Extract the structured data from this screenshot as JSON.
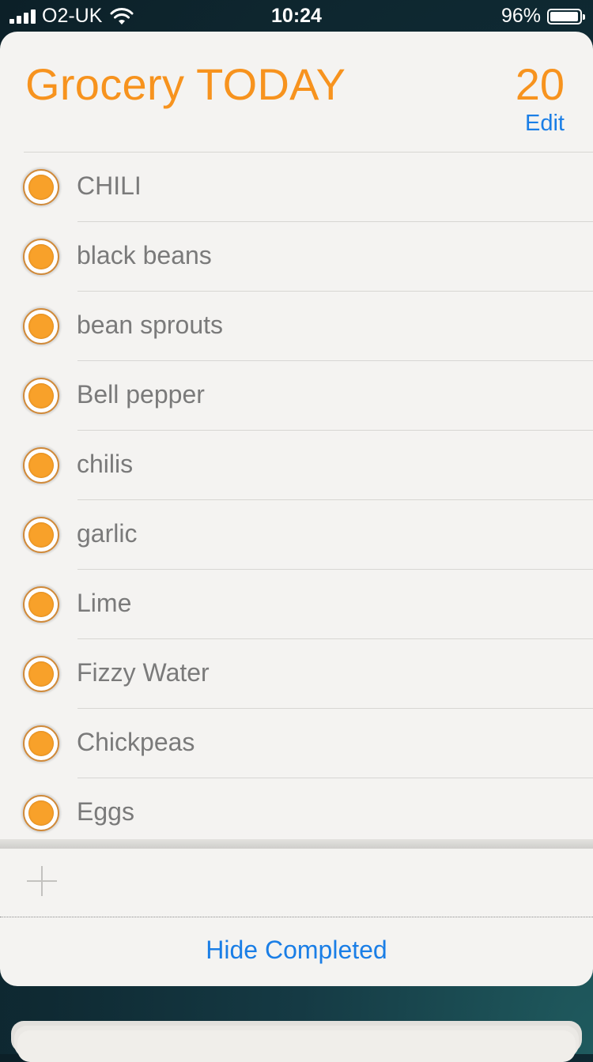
{
  "status_bar": {
    "carrier": "O2-UK",
    "time": "10:24",
    "battery_percent": "96%",
    "battery_level": 0.96
  },
  "list": {
    "title": "Grocery TODAY",
    "count": "20",
    "edit_label": "Edit",
    "items": [
      {
        "label": "CHILI"
      },
      {
        "label": "black beans"
      },
      {
        "label": "bean sprouts"
      },
      {
        "label": "Bell pepper"
      },
      {
        "label": "chilis"
      },
      {
        "label": "garlic"
      },
      {
        "label": "Lime"
      },
      {
        "label": "Fizzy Water"
      },
      {
        "label": "Chickpeas"
      },
      {
        "label": "Eggs"
      }
    ],
    "add_icon": "plus-icon",
    "hide_completed_label": "Hide Completed"
  },
  "colors": {
    "accent_orange": "#f7931e",
    "link_blue": "#1a7ee6"
  }
}
